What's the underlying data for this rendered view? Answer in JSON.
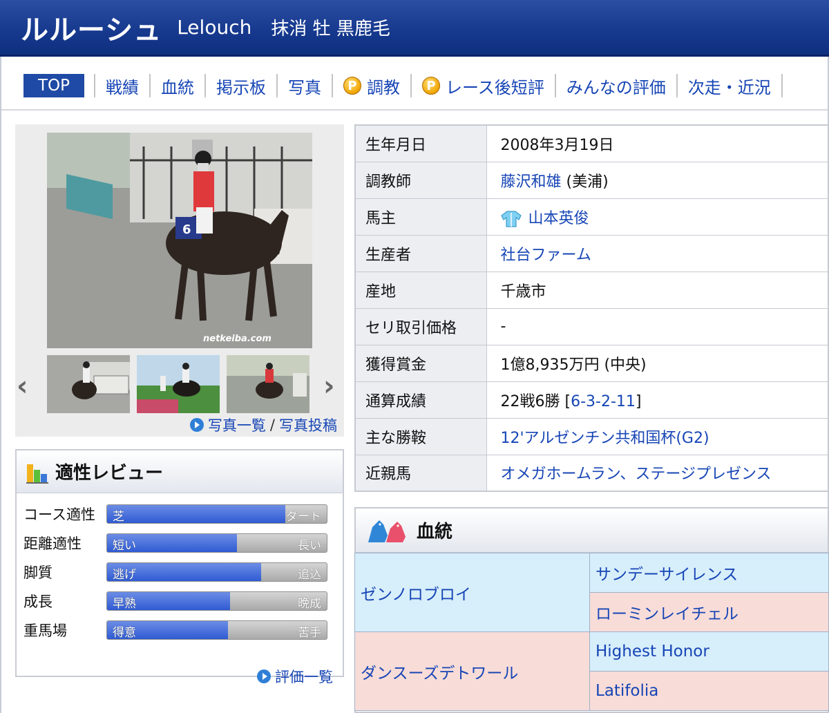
{
  "header": {
    "name_jp": "ルルーシュ",
    "name_en": "Lelouch",
    "status": "抹消 牡 黒鹿毛"
  },
  "nav": {
    "top": "TOP",
    "items": [
      "戦績",
      "血統",
      "掲示板",
      "写真",
      "調教",
      "レース後短評",
      "みんなの評価",
      "次走・近況"
    ],
    "premium_icon": "P"
  },
  "photos": {
    "watermark": "netkeiba.com",
    "number_cloth": "6",
    "list_link": "写真一覧",
    "separator": "/",
    "post_link": "写真投稿",
    "prev_icon": "‹",
    "next_icon": "›"
  },
  "review": {
    "title": "適性レビュー",
    "rows": [
      {
        "label": "コース適性",
        "left": "芝",
        "right": "ダート",
        "value": 0.81
      },
      {
        "label": "距離適性",
        "left": "短い",
        "right": "長い",
        "value": 0.59
      },
      {
        "label": "脚質",
        "left": "逃げ",
        "right": "追込",
        "value": 0.7
      },
      {
        "label": "成長",
        "left": "早熟",
        "right": "晩成",
        "value": 0.56
      },
      {
        "label": "重馬場",
        "left": "得意",
        "right": "苦手",
        "value": 0.55
      }
    ],
    "link": "評価一覧"
  },
  "profile": {
    "birth_label": "生年月日",
    "birth": "2008年3月19日",
    "trainer_label": "調教師",
    "trainer": "藤沢和雄",
    "trainer_loc": "(美浦)",
    "owner_label": "馬主",
    "owner": "山本英俊",
    "breeder_label": "生産者",
    "breeder": "社台ファーム",
    "origin_label": "産地",
    "origin": "千歳市",
    "auction_label": "セリ取引価格",
    "auction": "-",
    "prize_label": "獲得賞金",
    "prize": "1億8,935万円 (中央)",
    "record_label": "通算成績",
    "record": "22戦6勝",
    "record_detail": "6-3-2-11",
    "wins_label": "主な勝鞍",
    "wins": "12'アルゼンチン共和国杯(G2)",
    "relatives_label": "近親馬",
    "relatives": "オメガホームラン、ステージプレゼンス"
  },
  "pedigree": {
    "title": "血統",
    "sire": "ゼンノロブロイ",
    "sire_sire": "サンデーサイレンス",
    "sire_dam": "ローミンレイチェル",
    "dam": "ダンスーズデトワール",
    "dam_sire": "Highest Honor",
    "dam_dam": "Latifolia"
  },
  "colors": {
    "header_blue": "#173a8f",
    "link_blue": "#1645b5",
    "male_bg": "#d7eefb",
    "female_bg": "#f8dcd8"
  }
}
